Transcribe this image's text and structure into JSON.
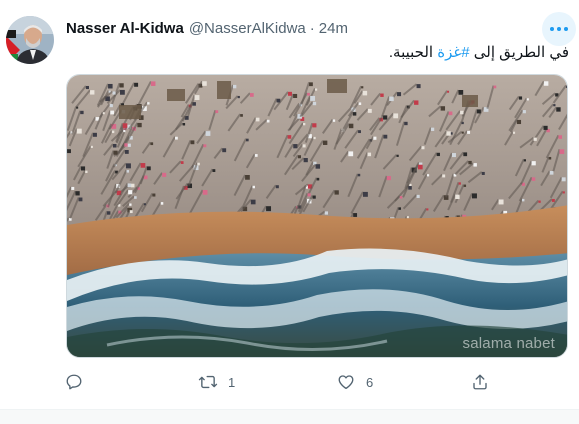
{
  "tweet": {
    "author": {
      "display_name": "Nasser Al-Kidwa",
      "handle": "@NasserAlKidwa",
      "separator": "·",
      "time": "24m"
    },
    "text": {
      "before": "في الطريق إلى ",
      "hashtag": "#غزة",
      "after": " الحبيبة."
    },
    "media": {
      "description_watermark": "salama nabet"
    },
    "actions": {
      "reply_count": "",
      "retweet_count": "1",
      "like_count": "6"
    }
  },
  "icons": {
    "avatar": "avatar",
    "more": "more-icon",
    "reply": "reply-icon",
    "retweet": "retweet-icon",
    "like": "heart-icon",
    "share": "share-icon"
  },
  "colors": {
    "accent": "#1d9bf0",
    "muted": "#536471",
    "text": "#0f1419"
  }
}
